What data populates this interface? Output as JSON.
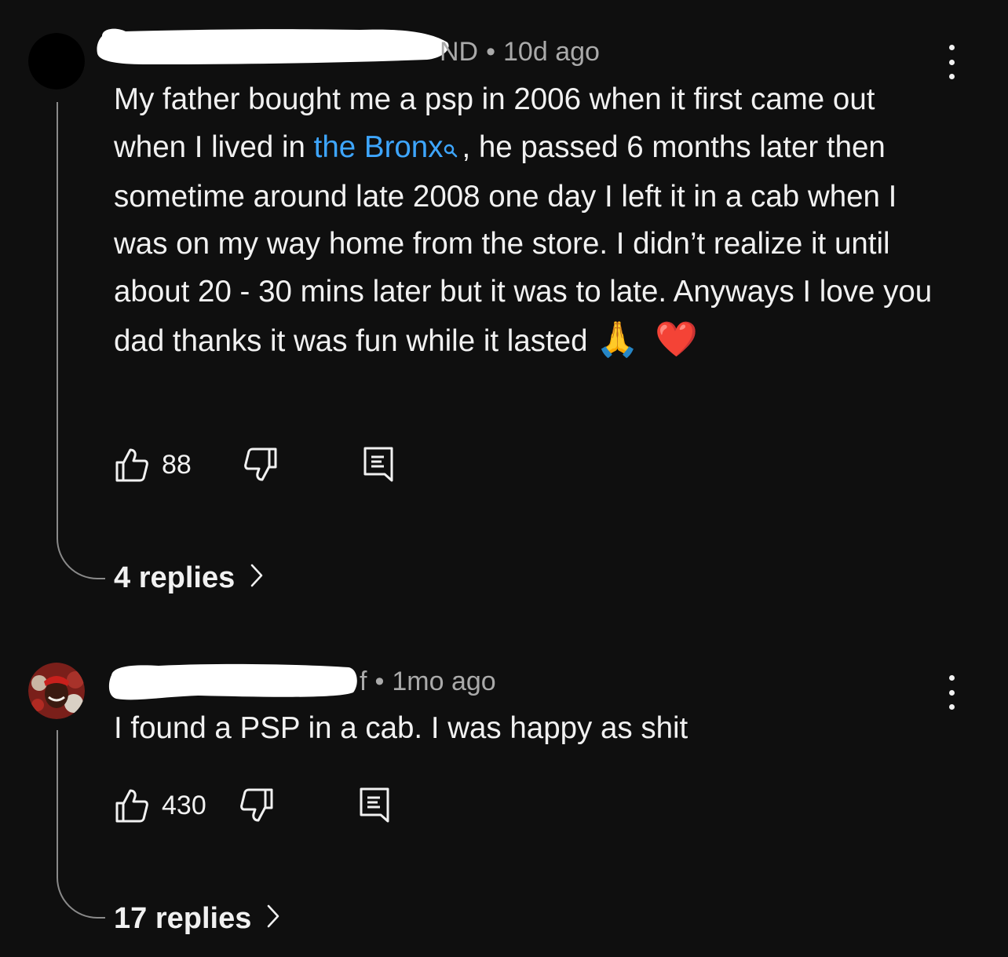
{
  "comments": [
    {
      "author_suffix": "ND",
      "time": "10d ago",
      "text_before_link": "My father bought me a psp in 2006 when it first came out when I lived in ",
      "link_text": "the Bronx",
      "text_after_link": ", he passed 6 months later then sometime around late 2008 one day I left it in a cab when I was on my way home from the store. I didn’t realize it until about 20 - 30 mins later but it was to late. Anyways I love you dad thanks it was fun while it lasted",
      "emojis": [
        "🙏",
        "❤️"
      ],
      "like_count": "88",
      "replies_label": "4 replies"
    },
    {
      "author_suffix": "f",
      "time": "1mo ago",
      "text": "I found a PSP in a cab. I was happy as shit",
      "like_count": "430",
      "replies_label": "17 replies"
    }
  ],
  "meta_separator": "•",
  "icons": {
    "like": "thumbs-up-icon",
    "dislike": "thumbs-down-icon",
    "reply": "reply-icon",
    "more": "more-vertical-icon",
    "search": "search-icon",
    "chevron": "chevron-right-icon"
  },
  "colors": {
    "background": "#0f0f0f",
    "text": "#f1f1f1",
    "secondary_text": "#aaaaaa",
    "link": "#3ea6ff"
  }
}
